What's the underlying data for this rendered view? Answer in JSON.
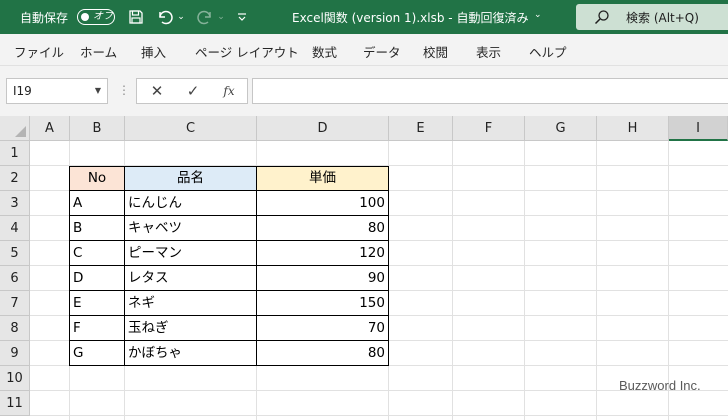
{
  "titlebar": {
    "autosave_label": "自動保存",
    "autosave_state": "オフ",
    "document_title": "Excel関数 (version 1).xlsb  -  自動回復済み",
    "search_text": "検索 (Alt+Q)"
  },
  "menu": [
    "ファイル",
    "ホーム",
    "挿入",
    "ページ レイアウト",
    "数式",
    "データ",
    "校閲",
    "表示",
    "ヘルプ"
  ],
  "formula_bar": {
    "name_box": "I19",
    "fx": "fx",
    "formula": ""
  },
  "columns": [
    "A",
    "B",
    "C",
    "D",
    "E",
    "F",
    "G",
    "H",
    "I"
  ],
  "active_column": "I",
  "rows": [
    "1",
    "2",
    "3",
    "4",
    "5",
    "6",
    "7",
    "8",
    "9",
    "10",
    "11"
  ],
  "table": {
    "headers": [
      "No",
      "品名",
      "単価"
    ],
    "header_colors": [
      "#fce4d6",
      "#ddebf7",
      "#fff2cc"
    ],
    "rows": [
      [
        "A",
        "にんじん",
        "100"
      ],
      [
        "B",
        "キャベツ",
        "80"
      ],
      [
        "C",
        "ピーマン",
        "120"
      ],
      [
        "D",
        "レタス",
        "90"
      ],
      [
        "E",
        "ネギ",
        "150"
      ],
      [
        "F",
        "玉ねぎ",
        "70"
      ],
      [
        "G",
        "かぼちゃ",
        "80"
      ]
    ]
  },
  "watermark": "Buzzword Inc.",
  "colors": {
    "ribbon_green": "#217346",
    "menu_bg": "#f3f3f3"
  }
}
